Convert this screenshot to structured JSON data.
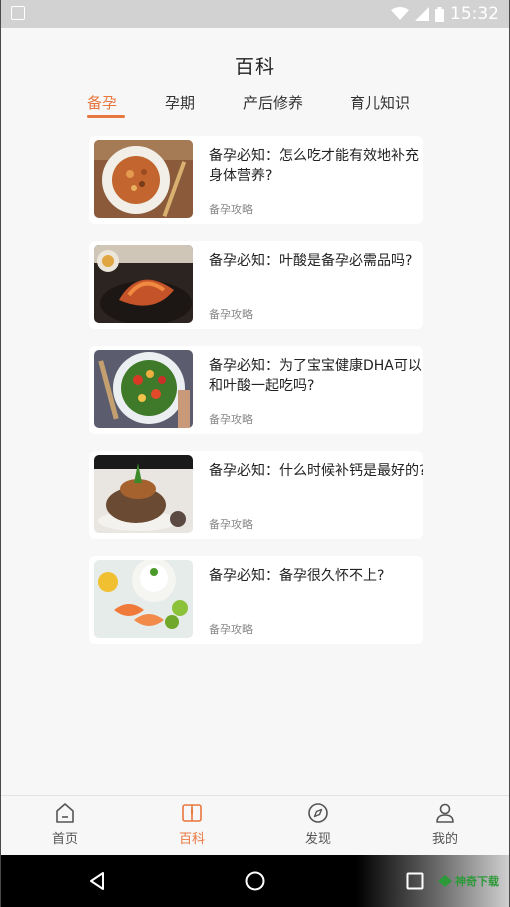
{
  "status_bar": {
    "time": "15:32"
  },
  "header": {
    "title": "百科"
  },
  "tabs": [
    {
      "label": "备孕",
      "active": true
    },
    {
      "label": "孕期",
      "active": false
    },
    {
      "label": "产后修养",
      "active": false
    },
    {
      "label": "育儿知识",
      "active": false
    }
  ],
  "articles": [
    {
      "title": "备孕必知：怎么吃才能有效地补充身体营养?",
      "tag": "备孕攻略"
    },
    {
      "title": "备孕必知：叶酸是备孕必需品吗?",
      "tag": "备孕攻略"
    },
    {
      "title": "备孕必知：为了宝宝健康DHA可以和叶酸一起吃吗?",
      "tag": "备孕攻略"
    },
    {
      "title": "备孕必知：什么时候补钙是最好的?",
      "tag": "备孕攻略"
    },
    {
      "title": "备孕必知：备孕很久怀不上?",
      "tag": "备孕攻略"
    }
  ],
  "bottom_nav": [
    {
      "label": "首页",
      "icon": "home-icon",
      "active": false
    },
    {
      "label": "百科",
      "icon": "book-icon",
      "active": true
    },
    {
      "label": "发现",
      "icon": "compass-icon",
      "active": false
    },
    {
      "label": "我的",
      "icon": "profile-icon",
      "active": false
    }
  ],
  "watermark": {
    "text": "神奇下载"
  },
  "colors": {
    "accent": "#e8773f",
    "background": "#f7f7f7",
    "card": "#ffffff"
  }
}
